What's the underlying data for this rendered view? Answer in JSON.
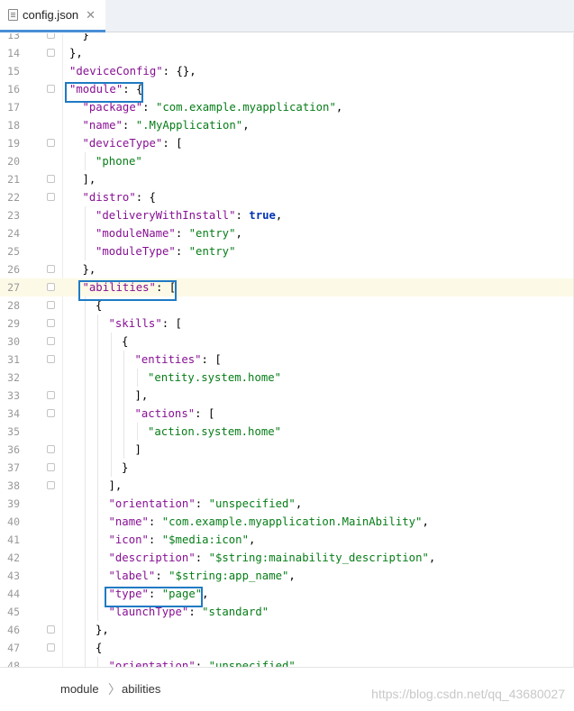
{
  "tab": {
    "filename": "config.json",
    "close_glyph": "✕"
  },
  "lines": [
    {
      "n": "13",
      "indent": 1,
      "t": [
        [
          "p",
          "}"
        ]
      ]
    },
    {
      "n": "14",
      "indent": 0,
      "t": [
        [
          "p",
          "},"
        ]
      ]
    },
    {
      "n": "15",
      "indent": 0,
      "t": [
        [
          "k",
          "\"deviceConfig\""
        ],
        [
          "p",
          ": {},"
        ]
      ]
    },
    {
      "n": "16",
      "indent": 0,
      "t": [
        [
          "k",
          "\"module\""
        ],
        [
          "p",
          ": {"
        ]
      ]
    },
    {
      "n": "17",
      "indent": 1,
      "t": [
        [
          "k",
          "\"package\""
        ],
        [
          "p",
          ": "
        ],
        [
          "s",
          "\"com.example.myapplication\""
        ],
        [
          "p",
          ","
        ]
      ]
    },
    {
      "n": "18",
      "indent": 1,
      "t": [
        [
          "k",
          "\"name\""
        ],
        [
          "p",
          ": "
        ],
        [
          "s",
          "\".MyApplication\""
        ],
        [
          "p",
          ","
        ]
      ]
    },
    {
      "n": "19",
      "indent": 1,
      "t": [
        [
          "k",
          "\"deviceType\""
        ],
        [
          "p",
          ": ["
        ]
      ]
    },
    {
      "n": "20",
      "indent": 2,
      "t": [
        [
          "s",
          "\"phone\""
        ]
      ]
    },
    {
      "n": "21",
      "indent": 1,
      "t": [
        [
          "p",
          "],"
        ]
      ]
    },
    {
      "n": "22",
      "indent": 1,
      "t": [
        [
          "k",
          "\"distro\""
        ],
        [
          "p",
          ": {"
        ]
      ]
    },
    {
      "n": "23",
      "indent": 2,
      "t": [
        [
          "k",
          "\"deliveryWithInstall\""
        ],
        [
          "p",
          ": "
        ],
        [
          "b",
          "true"
        ],
        [
          "p",
          ","
        ]
      ]
    },
    {
      "n": "24",
      "indent": 2,
      "t": [
        [
          "k",
          "\"moduleName\""
        ],
        [
          "p",
          ": "
        ],
        [
          "s",
          "\"entry\""
        ],
        [
          "p",
          ","
        ]
      ]
    },
    {
      "n": "25",
      "indent": 2,
      "t": [
        [
          "k",
          "\"moduleType\""
        ],
        [
          "p",
          ": "
        ],
        [
          "s",
          "\"entry\""
        ]
      ]
    },
    {
      "n": "26",
      "indent": 1,
      "t": [
        [
          "p",
          "},"
        ]
      ]
    },
    {
      "n": "27",
      "indent": 1,
      "t": [
        [
          "k",
          "\"abilities\""
        ],
        [
          "p",
          ": ["
        ]
      ]
    },
    {
      "n": "28",
      "indent": 2,
      "t": [
        [
          "p",
          "{"
        ]
      ]
    },
    {
      "n": "29",
      "indent": 3,
      "t": [
        [
          "k",
          "\"skills\""
        ],
        [
          "p",
          ": ["
        ]
      ]
    },
    {
      "n": "30",
      "indent": 4,
      "t": [
        [
          "p",
          "{"
        ]
      ]
    },
    {
      "n": "31",
      "indent": 5,
      "t": [
        [
          "k",
          "\"entities\""
        ],
        [
          "p",
          ": ["
        ]
      ]
    },
    {
      "n": "32",
      "indent": 6,
      "t": [
        [
          "s",
          "\"entity.system.home\""
        ]
      ]
    },
    {
      "n": "33",
      "indent": 5,
      "t": [
        [
          "p",
          "],"
        ]
      ]
    },
    {
      "n": "34",
      "indent": 5,
      "t": [
        [
          "k",
          "\"actions\""
        ],
        [
          "p",
          ": ["
        ]
      ]
    },
    {
      "n": "35",
      "indent": 6,
      "t": [
        [
          "s",
          "\"action.system.home\""
        ]
      ]
    },
    {
      "n": "36",
      "indent": 5,
      "t": [
        [
          "p",
          "]"
        ]
      ]
    },
    {
      "n": "37",
      "indent": 4,
      "t": [
        [
          "p",
          "}"
        ]
      ]
    },
    {
      "n": "38",
      "indent": 3,
      "t": [
        [
          "p",
          "],"
        ]
      ]
    },
    {
      "n": "39",
      "indent": 3,
      "t": [
        [
          "k",
          "\"orientation\""
        ],
        [
          "p",
          ": "
        ],
        [
          "s",
          "\"unspecified\""
        ],
        [
          "p",
          ","
        ]
      ]
    },
    {
      "n": "40",
      "indent": 3,
      "t": [
        [
          "k",
          "\"name\""
        ],
        [
          "p",
          ": "
        ],
        [
          "s",
          "\"com.example.myapplication.MainAbility\""
        ],
        [
          "p",
          ","
        ]
      ]
    },
    {
      "n": "41",
      "indent": 3,
      "t": [
        [
          "k",
          "\"icon\""
        ],
        [
          "p",
          ": "
        ],
        [
          "s",
          "\"$media:icon\""
        ],
        [
          "p",
          ","
        ]
      ]
    },
    {
      "n": "42",
      "indent": 3,
      "t": [
        [
          "k",
          "\"description\""
        ],
        [
          "p",
          ": "
        ],
        [
          "s",
          "\"$string:mainability_description\""
        ],
        [
          "p",
          ","
        ]
      ]
    },
    {
      "n": "43",
      "indent": 3,
      "t": [
        [
          "k",
          "\"label\""
        ],
        [
          "p",
          ": "
        ],
        [
          "s",
          "\"$string:app_name\""
        ],
        [
          "p",
          ","
        ]
      ]
    },
    {
      "n": "44",
      "indent": 3,
      "t": [
        [
          "k",
          "\"type\""
        ],
        [
          "p",
          ": "
        ],
        [
          "s",
          "\"page\""
        ],
        [
          "p",
          ","
        ]
      ]
    },
    {
      "n": "45",
      "indent": 3,
      "t": [
        [
          "k",
          "\"launchType\""
        ],
        [
          "p",
          ": "
        ],
        [
          "s",
          "\"standard\""
        ]
      ]
    },
    {
      "n": "46",
      "indent": 2,
      "t": [
        [
          "p",
          "},"
        ]
      ]
    },
    {
      "n": "47",
      "indent": 2,
      "t": [
        [
          "p",
          "{"
        ]
      ]
    },
    {
      "n": "48",
      "indent": 3,
      "t": [
        [
          "k",
          "\"orientation\""
        ],
        [
          "p",
          ": "
        ],
        [
          "s",
          "\"unspecified\""
        ]
      ]
    }
  ],
  "current_line": "27",
  "highlighted_lines": [
    "16",
    "27",
    "44"
  ],
  "breadcrumb": {
    "item1": "module",
    "separator": "〉",
    "item2": "abilities"
  },
  "watermark": "https://blog.csdn.net/qq_43680027",
  "colors": {
    "key": "#871094",
    "string": "#067d17",
    "keyword": "#0033b3",
    "highlight_box": "#1f7ac4",
    "tab_underline": "#4a8fd6"
  }
}
